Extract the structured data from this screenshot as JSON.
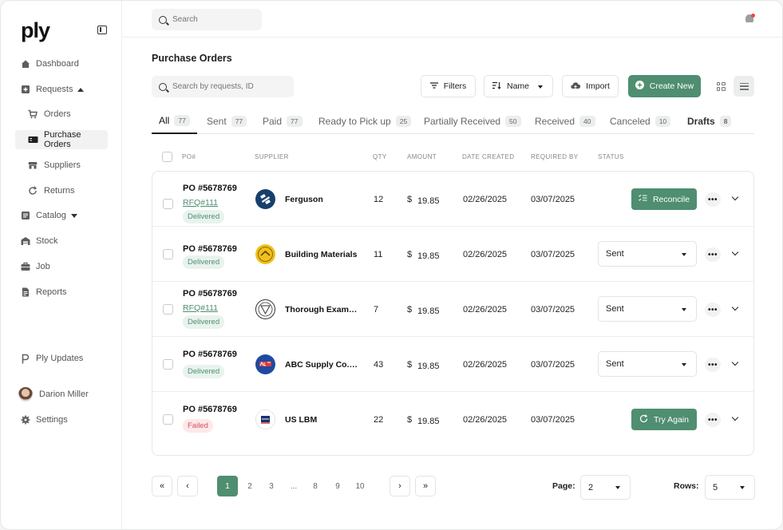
{
  "app": {
    "logo": "ply"
  },
  "sidebar": {
    "items": [
      {
        "label": "Dashboard",
        "icon": "home-icon"
      },
      {
        "label": "Requests",
        "icon": "plus-box-icon"
      },
      {
        "label": "Orders",
        "icon": "cart-icon"
      },
      {
        "label": "Purchase Orders",
        "icon": "receipt-icon"
      },
      {
        "label": "Suppliers",
        "icon": "store-icon"
      },
      {
        "label": "Returns",
        "icon": "refresh-icon"
      },
      {
        "label": "Catalog",
        "icon": "catalog-icon"
      },
      {
        "label": "Stock",
        "icon": "warehouse-icon"
      },
      {
        "label": "Job",
        "icon": "briefcase-icon"
      },
      {
        "label": "Reports",
        "icon": "document-icon"
      }
    ],
    "updates_label": "Ply Updates",
    "user_name": "Darion Miller",
    "settings_label": "Settings"
  },
  "topbar": {
    "search_placeholder": "Search"
  },
  "main": {
    "title": "Purchase Orders",
    "search_placeholder": "Search by requests, ID",
    "filters_label": "Filters",
    "sort_label": "Name",
    "import_label": "Import",
    "create_label": "Create New",
    "tabs": [
      {
        "label": "All",
        "count": "77"
      },
      {
        "label": "Sent",
        "count": "77"
      },
      {
        "label": "Paid",
        "count": "77"
      },
      {
        "label": "Ready to Pick up",
        "count": "25"
      },
      {
        "label": "Partially Received",
        "count": "50"
      },
      {
        "label": "Received",
        "count": "40"
      },
      {
        "label": "Canceled",
        "count": "10"
      },
      {
        "label": "Drafts",
        "count": "8"
      }
    ],
    "columns": [
      "PO#",
      "SUPPLIER",
      "QTY",
      "AMOUNT",
      "DATE CREATED",
      "REQUIRED BY",
      "STATUS"
    ],
    "rows": [
      {
        "po": "PO #5678769",
        "rfq": "RFQ#111",
        "badge": "Delivered",
        "supplier": "Ferguson",
        "qty": "12",
        "currency": "$",
        "amount": "19.85",
        "created": "02/26/2025",
        "required": "03/07/2025",
        "action": "Reconcile"
      },
      {
        "po": "PO #5678769",
        "rfq": "",
        "badge": "Delivered",
        "supplier": "Building Materials",
        "qty": "11",
        "currency": "$",
        "amount": "19.85",
        "created": "02/26/2025",
        "required": "03/07/2025",
        "status": "Sent"
      },
      {
        "po": "PO #5678769",
        "rfq": "RFQ#111",
        "badge": "Delivered",
        "supplier": "Thorough Examination",
        "qty": "7",
        "currency": "$",
        "amount": "19.85",
        "created": "02/26/2025",
        "required": "03/07/2025",
        "status": "Sent"
      },
      {
        "po": "PO #5678769",
        "rfq": "",
        "badge": "Delivered",
        "supplier": "ABC Supply Co. Inc.",
        "qty": "43",
        "currency": "$",
        "amount": "19.85",
        "created": "02/26/2025",
        "required": "03/07/2025",
        "status": "Sent"
      },
      {
        "po": "PO #5678769",
        "rfq": "",
        "badge": "Failed",
        "supplier": "US LBM",
        "qty": "22",
        "currency": "$",
        "amount": "19.85",
        "created": "02/26/2025",
        "required": "03/07/2025",
        "action": "Try Again"
      }
    ],
    "ellipsis": "•••"
  },
  "pagination": {
    "first": "«",
    "prev": "‹",
    "next": "›",
    "last": "»",
    "pages": [
      "1",
      "2",
      "3",
      "...",
      "8",
      "9",
      "10"
    ],
    "page_label": "Page:",
    "page_value": "2",
    "rows_label": "Rows:",
    "rows_value": "5"
  },
  "colors": {
    "accent": "#4f8e70",
    "failed": "#d2505d",
    "notification": "#e34b4b"
  }
}
